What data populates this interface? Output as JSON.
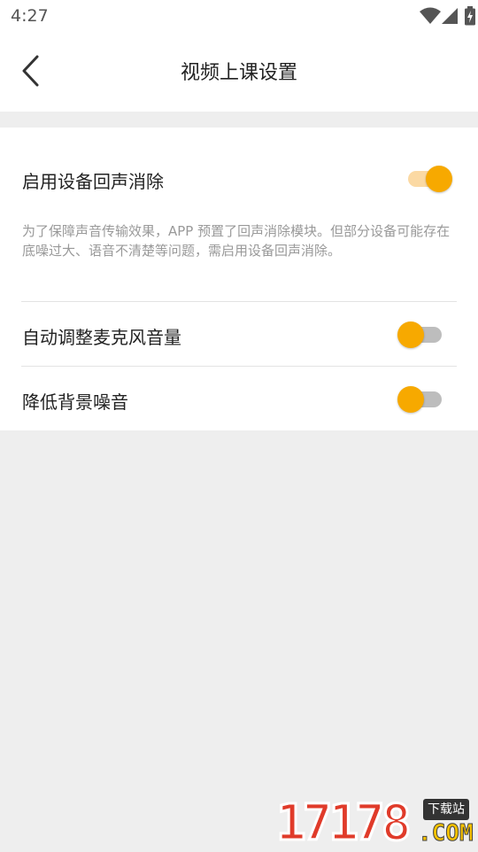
{
  "status_bar": {
    "time": "4:27",
    "icons": [
      "wifi-icon",
      "cellular-signal-icon",
      "battery-charging-icon"
    ]
  },
  "header": {
    "back_icon": "chevron-left-icon",
    "title": "视频上课设置"
  },
  "settings": [
    {
      "label": "启用设备回声消除",
      "enabled": true,
      "description": "为了保障声音传输效果，APP 预置了回声消除模块。但部分设备可能存在底噪过大、语音不清楚等问题，需启用设备回声消除。"
    },
    {
      "label": "自动调整麦克风音量",
      "enabled": false
    },
    {
      "label": "降低背景噪音",
      "enabled": false
    }
  ],
  "colors": {
    "accent": "#f7a900",
    "accent_track": "#fbd9a3",
    "off_track": "#bdbdbd",
    "page_background": "#eeeeee",
    "description_text": "#999999"
  },
  "watermark": {
    "digits": "17178",
    "badge": "下载站",
    "domain": ".COM"
  }
}
